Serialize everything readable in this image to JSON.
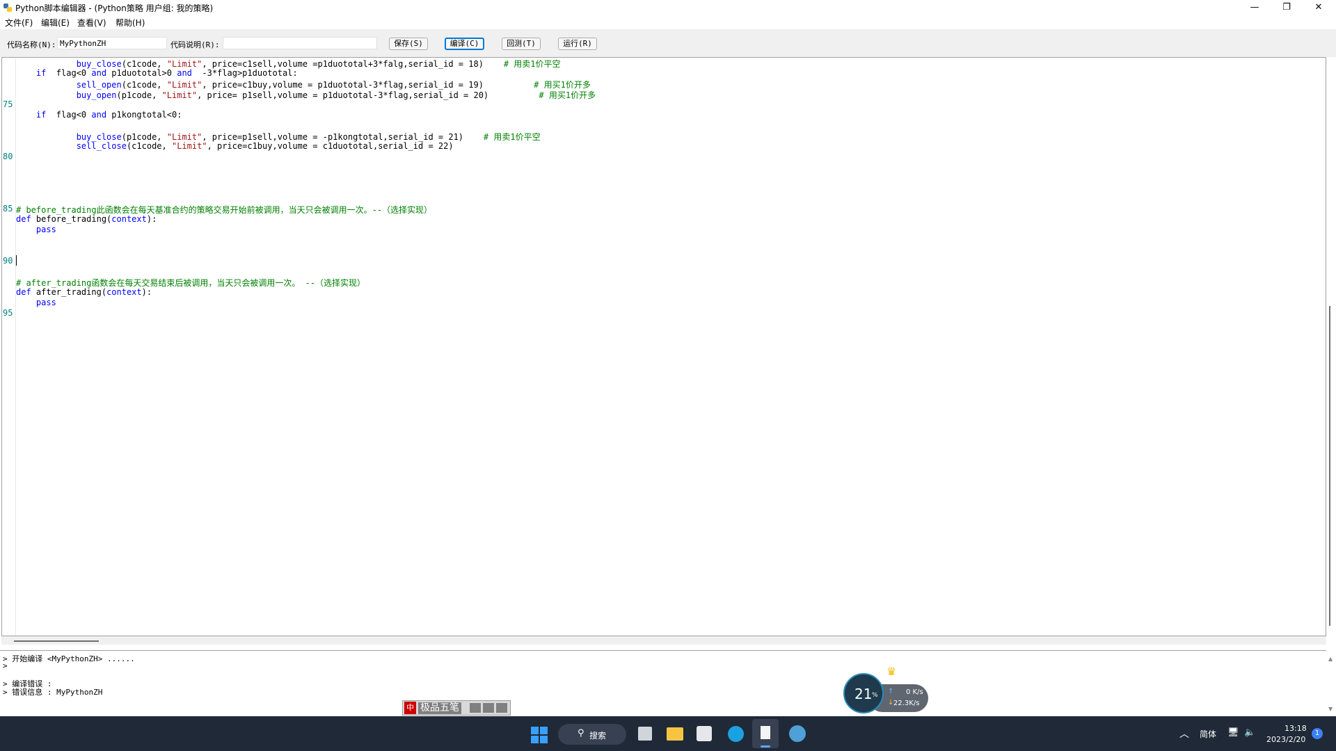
{
  "window": {
    "title": "Python脚本编辑器 - (Python策略 用户组: 我的策略)",
    "minimize_glyph": "—",
    "maximize_glyph": "❐",
    "close_glyph": "✕"
  },
  "menu": {
    "items": [
      "文件(F)",
      "编辑(E)",
      "查看(V)",
      "帮助(H)"
    ]
  },
  "toolbar": {
    "code_name_label": "代码名称(N):",
    "code_name_value": "MyPythonZH",
    "code_desc_label": "代码说明(R):",
    "code_desc_value": "",
    "save_label": "保存(S)",
    "compile_label": "编译(C)",
    "backtest_label": "回测(T)",
    "run_label": "运行(R)"
  },
  "editor": {
    "line_numbers": [
      "75",
      "80",
      "85",
      "90",
      "95"
    ],
    "lines": [
      [
        {
          "t": "            "
        },
        {
          "t": "buy_close",
          "c": "fn"
        },
        {
          "t": "(c1code, "
        },
        {
          "t": "\"Limit\"",
          "c": "str"
        },
        {
          "t": ", price=c1sell,volume =p1duototal+3*falg,serial_id = 18)    "
        },
        {
          "t": "# 用卖1价平空",
          "c": "cm"
        }
      ],
      [
        {
          "t": "    "
        },
        {
          "t": "if",
          "c": "kw"
        },
        {
          "t": "  flag<0 "
        },
        {
          "t": "and",
          "c": "kw"
        },
        {
          "t": " p1duototal>0 "
        },
        {
          "t": "and",
          "c": "kw"
        },
        {
          "t": "  -3*flag>p1duototal:"
        }
      ],
      [
        {
          "t": "            "
        },
        {
          "t": "sell_open",
          "c": "fn"
        },
        {
          "t": "(c1code, "
        },
        {
          "t": "\"Limit\"",
          "c": "str"
        },
        {
          "t": ", price=c1buy,volume = p1duototal-3*flag,serial_id = 19)          "
        },
        {
          "t": "# 用买1价开多",
          "c": "cm"
        }
      ],
      [
        {
          "t": "            "
        },
        {
          "t": "buy_open",
          "c": "fn"
        },
        {
          "t": "(p1code, "
        },
        {
          "t": "\"Limit\"",
          "c": "str"
        },
        {
          "t": ", price= p1sell,volume = p1duototal-3*flag,serial_id = 20)          "
        },
        {
          "t": "# 用买1价开多",
          "c": "cm"
        }
      ],
      [],
      [
        {
          "t": "    "
        },
        {
          "t": "if",
          "c": "kw"
        },
        {
          "t": "  flag<0 "
        },
        {
          "t": "and",
          "c": "kw"
        },
        {
          "t": " p1kongtotal<0:"
        }
      ],
      [],
      [
        {
          "t": "            "
        },
        {
          "t": "buy_close",
          "c": "fn"
        },
        {
          "t": "(p1code, "
        },
        {
          "t": "\"Limit\"",
          "c": "str"
        },
        {
          "t": ", price=p1sell,volume = -p1kongtotal,serial_id = 21)    "
        },
        {
          "t": "# 用卖1价平空",
          "c": "cm"
        }
      ],
      [
        {
          "t": "            "
        },
        {
          "t": "sell_close",
          "c": "fn"
        },
        {
          "t": "(c1code, "
        },
        {
          "t": "\"Limit\"",
          "c": "str"
        },
        {
          "t": ", price=c1buy,volume = c1duototal,serial_id = 22)"
        }
      ],
      [],
      [],
      [],
      [],
      [],
      [
        {
          "t": "# before_trading此函数会在每天基准合约的策略交易开始前被调用，当天只会被调用一次。--（选择实现）",
          "c": "cm"
        }
      ],
      [
        {
          "t": "def",
          "c": "kw"
        },
        {
          "t": " before_trading("
        },
        {
          "t": "context",
          "c": "fn"
        },
        {
          "t": "):"
        }
      ],
      [
        {
          "t": "    "
        },
        {
          "t": "pass",
          "c": "kw"
        }
      ],
      [],
      [],
      [],
      [],
      [
        {
          "t": "# after_trading函数会在每天交易结束后被调用，当天只会被调用一次。 --（选择实现）",
          "c": "cm"
        }
      ],
      [
        {
          "t": "def",
          "c": "kw"
        },
        {
          "t": " after_trading("
        },
        {
          "t": "context",
          "c": "fn"
        },
        {
          "t": "):"
        }
      ],
      [
        {
          "t": "    "
        },
        {
          "t": "pass",
          "c": "kw"
        }
      ]
    ]
  },
  "output": {
    "lines": [
      "> 开始编译 <MyPythonZH> ......",
      ">",
      "",
      "> 编译错误 :",
      "> 错误信息 : MyPythonZH"
    ]
  },
  "ime": {
    "label": "极品五笔",
    "logo_char": "中"
  },
  "net_widget": {
    "cpu_percent": "21",
    "percent_sign": "%",
    "upload": "0 K/s",
    "download": "22.3K/s"
  },
  "taskbar": {
    "search_label": "搜索",
    "lang_label": "简体",
    "time": "13:18",
    "date": "2023/2/20",
    "notification_count": "1"
  },
  "colors": {
    "accent": "#0078d7",
    "keyword": "#0000ff",
    "string": "#a31515",
    "comment": "#008000",
    "line_number": "#008080",
    "taskbar": "#1f2937"
  }
}
